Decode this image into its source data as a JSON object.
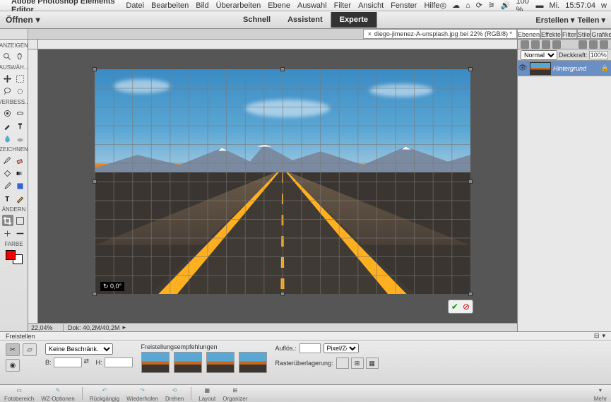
{
  "macbar": {
    "app": "Adobe Photoshop Elements Editor",
    "menus": [
      "Datei",
      "Bearbeiten",
      "Bild",
      "Überarbeiten",
      "Ebene",
      "Auswahl",
      "Filter",
      "Ansicht",
      "Fenster",
      "Hilfe"
    ],
    "battery": "100 %",
    "day": "Mi.",
    "time": "15:57:04",
    "user": "w"
  },
  "toolbar": {
    "open": "Öffnen",
    "modes": {
      "quick": "Schnell",
      "assist": "Assistent",
      "expert": "Experte"
    },
    "create": "Erstellen",
    "share": "Teilen"
  },
  "doc": {
    "tab": "diego-jimenez-A-unsplash.jpg bei 22% (RGB/8) *",
    "zoom": "22,04%",
    "size": "Dok: 40,2M/40,2M",
    "angle": "↻ 0,0°"
  },
  "panels": {
    "tabs": [
      "Ebenen",
      "Effekte",
      "Filter",
      "Stile",
      "Grafike"
    ],
    "blend": "Normal",
    "opacity_label": "Deckkraft:",
    "opacity": "100%",
    "layer_name": "Hintergrund"
  },
  "toolbox": {
    "sections": [
      "ANZEIGEN",
      "AUSWÄH...",
      "VERBESS...",
      "ZEICHNEN",
      "ÄNDERN",
      "FARBE"
    ]
  },
  "options": {
    "title": "Freistellen",
    "aspect": "Keine Beschränk.",
    "w_label": "B:",
    "h_label": "H:",
    "suggest_label": "Freistellungsempfehlungen",
    "res_label": "Auflös.:",
    "res_unit": "Pixel/Zen...",
    "overlay_label": "Rasterüberlagerung:"
  },
  "dock": {
    "items": [
      "Fotobereich",
      "WZ-Optionen",
      "Rückgängig",
      "Wiederholen",
      "Drehen",
      "Layout",
      "Organizer"
    ],
    "more": "Mehr"
  }
}
